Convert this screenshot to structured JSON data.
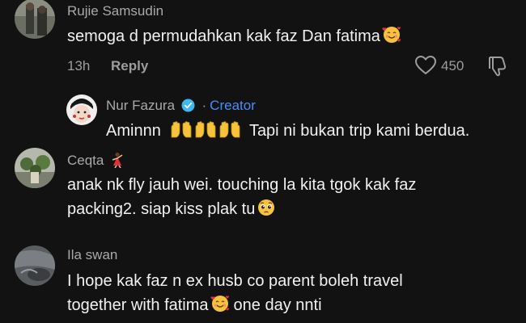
{
  "comments": [
    {
      "username": "Rujie Samsudin",
      "text": "semoga d permudahkan kak faz Dan fatima",
      "emoji": "smiling-face-with-hearts",
      "time": "13h",
      "reply_label": "Reply",
      "likes": "450"
    },
    {
      "username": "Nur Fazura",
      "verified": true,
      "creator_label": "Creator",
      "text_before": "Aminnn",
      "emojis": [
        "raised-hands",
        "raised-hands",
        "raised-hands"
      ],
      "text_after": "Tapi ni bukan trip kami berdua."
    },
    {
      "username": "Ceqta",
      "username_emoji": "woman-dancing",
      "line1": "anak nk fly jauh wei. touching la kita tgok kak faz",
      "line2": "packing2. siap kiss plak tu",
      "emoji": "pleading-face"
    },
    {
      "username": "Ila swan",
      "line1": "I hope kak faz n ex husb co parent boleh travel",
      "line2_before": "together with fatima",
      "emoji": "smiling-face-with-hearts",
      "line2_after": "one day nnti"
    }
  ],
  "colors": {
    "background": "#121212",
    "username": "#a9a9a9",
    "text": "#f1f1f1",
    "meta": "#9d9d9d",
    "creator": "#4a8cf6"
  }
}
